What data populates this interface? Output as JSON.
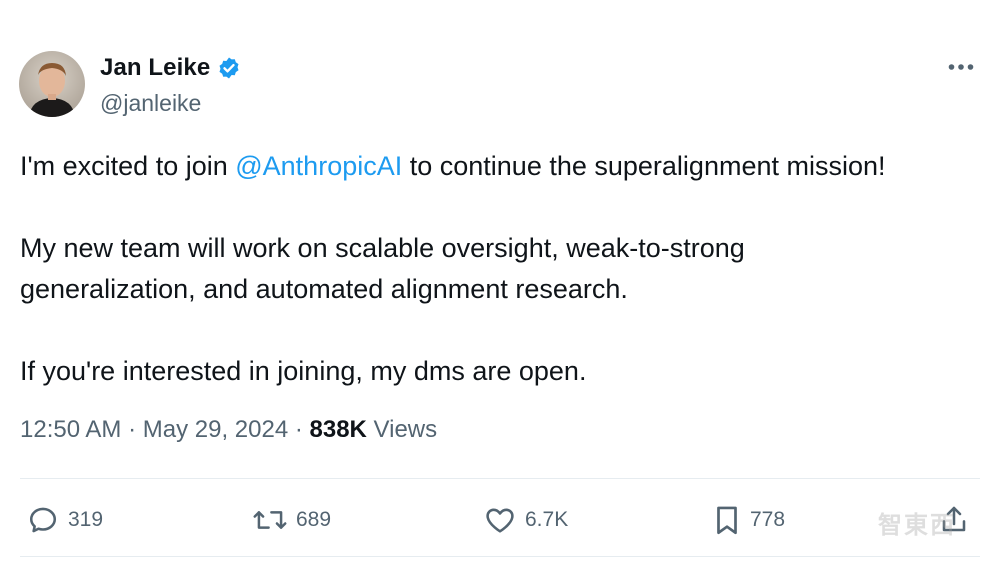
{
  "author": {
    "name": "Jan Leike",
    "handle": "@janleike",
    "verified": true,
    "avatar_icon": "person-photo-icon"
  },
  "tweet": {
    "line1_prefix": "I'm excited to join ",
    "line1_mention": "@AnthropicAI",
    "line1_suffix": " to continue the superalignment mission!",
    "para2_line1": "My new team will work on scalable oversight, weak-to-strong",
    "para2_line2": "generalization, and automated alignment research.",
    "para3": "If you're interested in joining, my dms are open."
  },
  "meta": {
    "time": "12:50 AM",
    "separator1": " · ",
    "date": "May 29, 2024",
    "separator2": " · ",
    "views_count": "838K",
    "views_label": " Views"
  },
  "actions": {
    "replies": "319",
    "reposts": "689",
    "likes": "6.7K",
    "bookmarks": "778"
  },
  "colors": {
    "link": "#1d9bf0",
    "secondary_text": "#536471",
    "primary_text": "#0f1419",
    "verified": "#1d9bf0"
  },
  "watermark": "智東西"
}
